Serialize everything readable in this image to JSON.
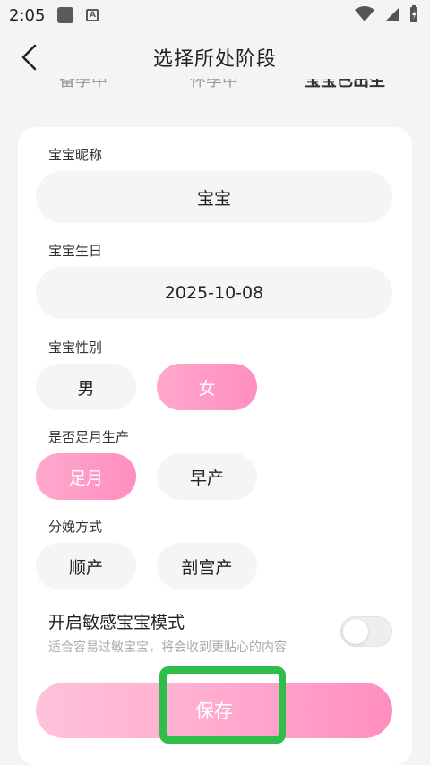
{
  "status_bar": {
    "time": "2:05",
    "notif_badge": "A"
  },
  "header": {
    "title": "选择所处阶段"
  },
  "stage_tabs": [
    {
      "label": "备孕中",
      "active": false
    },
    {
      "label": "怀孕中",
      "active": false
    },
    {
      "label": "宝宝已出生",
      "active": true
    }
  ],
  "form": {
    "nickname_label": "宝宝昵称",
    "nickname_value": "宝宝",
    "birthday_label": "宝宝生日",
    "birthday_value": "2025-10-08",
    "gender_label": "宝宝性别",
    "gender_options": [
      "男",
      "女"
    ],
    "gender_selected": "女",
    "term_label": "是否足月生产",
    "term_options": [
      "足月",
      "早产"
    ],
    "term_selected": "足月",
    "delivery_label": "分娩方式",
    "delivery_options": [
      "顺产",
      "剖宫产"
    ],
    "sensitive_title": "开启敏感宝宝模式",
    "sensitive_desc": "适合容易过敏宝宝，将会收到更贴心的内容",
    "sensitive_enabled": false,
    "save_label": "保存"
  },
  "colors": {
    "accent_pink_start": "#ffa8cc",
    "accent_pink_end": "#ff8ec0",
    "highlight_green": "#2fbe4a"
  }
}
